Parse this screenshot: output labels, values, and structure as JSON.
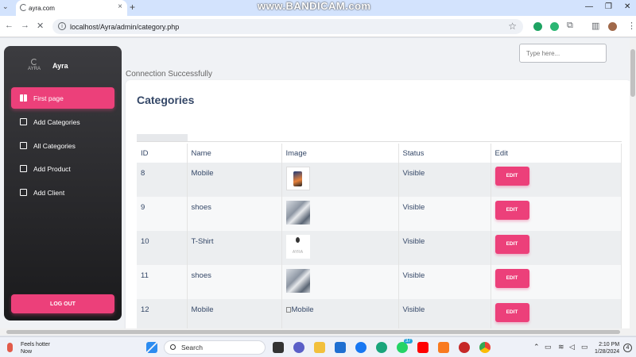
{
  "browser": {
    "tab_title": "ayra.com",
    "url": "localhost/Ayra/admin/category.php",
    "watermark": "www.BANDICAM.com"
  },
  "sidebar": {
    "brand_logo_text": "AYRA",
    "brand_name": "Ayra",
    "items": [
      {
        "label": "First page"
      },
      {
        "label": "Add Categories"
      },
      {
        "label": "All Categories"
      },
      {
        "label": "Add Product"
      },
      {
        "label": "Add Client"
      }
    ],
    "logout_label": "LOG OUT"
  },
  "header": {
    "search_placeholder": "Type here..."
  },
  "main": {
    "connection_message": "Connection Successfully",
    "title": "Categories",
    "table": {
      "headers": [
        "ID",
        "Name",
        "Image",
        "Status",
        "Edit"
      ],
      "rows": [
        {
          "id": "8",
          "name": "Mobile",
          "image": "phone",
          "status": "Visible",
          "edit": "EDIT"
        },
        {
          "id": "9",
          "name": "shoes",
          "image": "shoe",
          "status": "Visible",
          "edit": "EDIT"
        },
        {
          "id": "10",
          "name": "T-Shirt",
          "image": "logo",
          "logo_text": "AYRA",
          "status": "Visible",
          "edit": "EDIT"
        },
        {
          "id": "11",
          "name": "shoes",
          "image": "shoe",
          "status": "Visible",
          "edit": "EDIT"
        },
        {
          "id": "12",
          "name": "Mobile",
          "image": "broken",
          "alt": "Mobile",
          "status": "Visible",
          "edit": "EDIT"
        }
      ]
    }
  },
  "taskbar": {
    "weather_line1": "Feels hotter",
    "weather_line2": "Now",
    "search_label": "Search",
    "whatsapp_badge": "37",
    "time": "2:10 PM",
    "date": "1/28/2024",
    "notification_count": "4"
  },
  "colors": {
    "accent": "#ec407a",
    "sidebar_top": "#3c3c40",
    "sidebar_bottom": "#1a1a1c",
    "heading": "#344767"
  }
}
